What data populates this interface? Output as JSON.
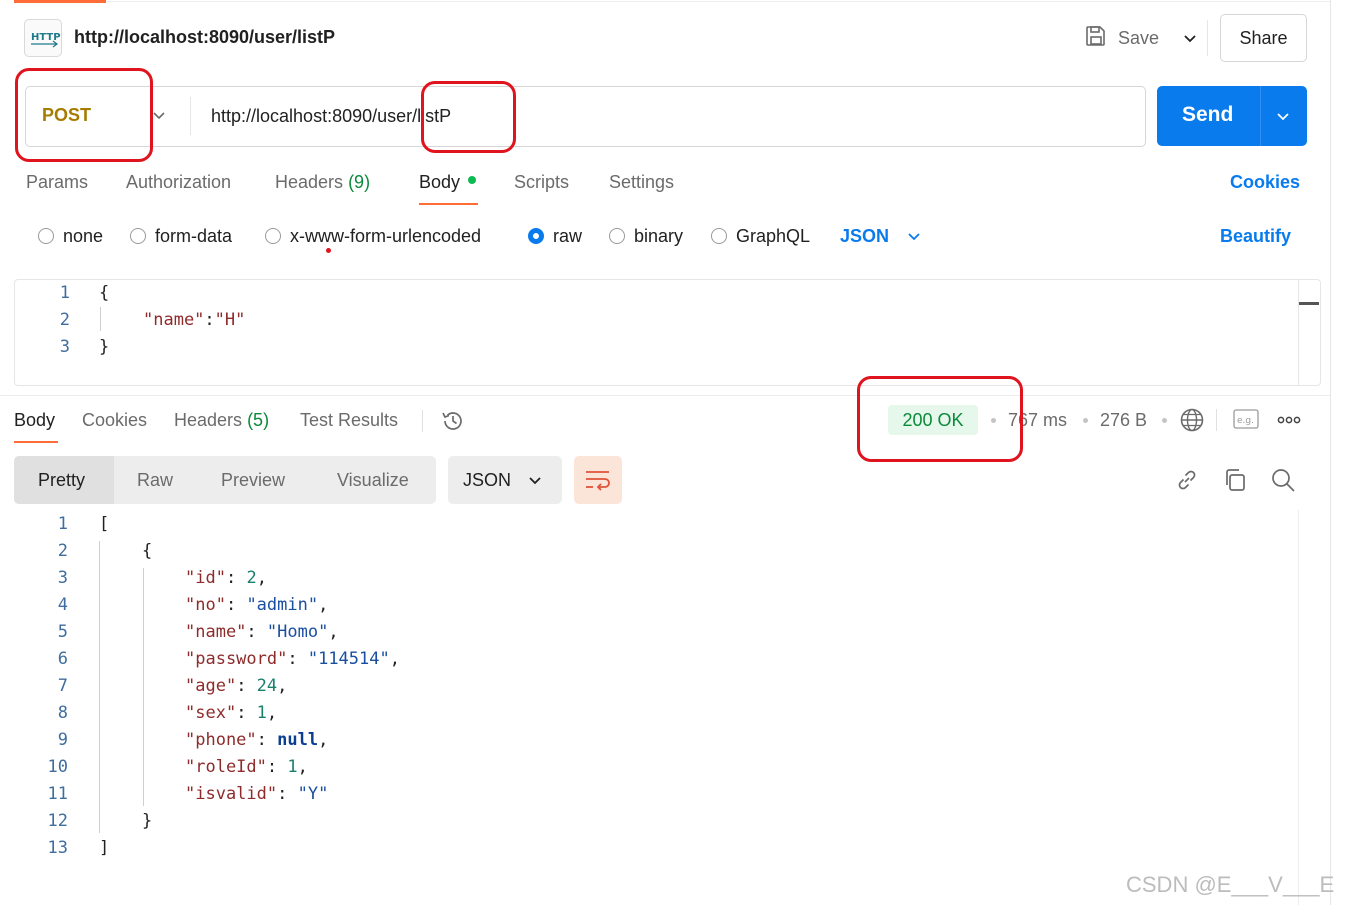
{
  "request": {
    "title": "http://localhost:8090/user/listP",
    "save_label": "Save",
    "share_label": "Share",
    "method": "POST",
    "url": "http://localhost:8090/user/listP",
    "send_label": "Send"
  },
  "request_tabs": [
    {
      "label": "Params"
    },
    {
      "label": "Authorization"
    },
    {
      "label": "Headers",
      "count": "(9)"
    },
    {
      "label": "Body"
    },
    {
      "label": "Scripts"
    },
    {
      "label": "Settings"
    }
  ],
  "cookies_label": "Cookies",
  "body_types": [
    "none",
    "form-data",
    "x-www-form-urlencoded",
    "raw",
    "binary",
    "GraphQL"
  ],
  "body_format": "JSON",
  "beautify_label": "Beautify",
  "request_body": {
    "line_numbers": [
      "1",
      "2",
      "3"
    ],
    "open": "{",
    "key": "\"name\"",
    "colon": ":",
    "value": "\"H\"",
    "close": "}"
  },
  "response_tabs": [
    {
      "label": "Body"
    },
    {
      "label": "Cookies"
    },
    {
      "label": "Headers",
      "count": "(5)"
    },
    {
      "label": "Test Results"
    }
  ],
  "response_meta": {
    "status": "200 OK",
    "time": "767 ms",
    "size": "276 B"
  },
  "view_modes": [
    "Pretty",
    "Raw",
    "Preview",
    "Visualize"
  ],
  "response_format": "JSON",
  "response_body": {
    "line_numbers": [
      "1",
      "2",
      "3",
      "4",
      "5",
      "6",
      "7",
      "8",
      "9",
      "10",
      "11",
      "12",
      "13"
    ],
    "open_array": "[",
    "open_obj": "{",
    "fields": [
      {
        "key": "\"id\"",
        "value": "2",
        "type": "num"
      },
      {
        "key": "\"no\"",
        "value": "\"admin\"",
        "type": "str"
      },
      {
        "key": "\"name\"",
        "value": "\"Homo\"",
        "type": "str"
      },
      {
        "key": "\"password\"",
        "value": "\"114514\"",
        "type": "str"
      },
      {
        "key": "\"age\"",
        "value": "24",
        "type": "num"
      },
      {
        "key": "\"sex\"",
        "value": "1",
        "type": "num"
      },
      {
        "key": "\"phone\"",
        "value": "null",
        "type": "kw"
      },
      {
        "key": "\"roleId\"",
        "value": "1",
        "type": "num"
      },
      {
        "key": "\"isvalid\"",
        "value": "\"Y\"",
        "type": "str"
      }
    ],
    "close_obj": "}",
    "close_array": "]"
  },
  "watermark": "CSDN @E___V___E",
  "colors": {
    "accent": "#ff6c37",
    "primary": "#097bed",
    "method": "#a67c00",
    "status_green": "#0b8a3a",
    "annotation_red": "#e0141e"
  },
  "icons": [
    "http-icon",
    "save-icon",
    "chevron-down-icon",
    "history-icon",
    "globe-icon",
    "example-icon",
    "more-icon",
    "wrap-lines-icon",
    "link-icon",
    "copy-icon",
    "search-icon"
  ]
}
